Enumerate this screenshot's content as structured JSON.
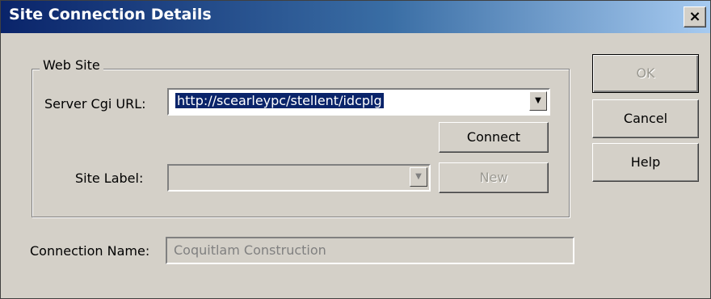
{
  "window": {
    "title": "Site Connection Details",
    "close_glyph": "×"
  },
  "web_site": {
    "group_label": "Web Site",
    "server_url_label": "Server Cgi URL:",
    "server_url_value": "http://scearleypc/stellent/idcplg",
    "connect_label": "Connect",
    "site_label_label": "Site Label:",
    "site_label_value": "",
    "new_label": "New"
  },
  "connection_name": {
    "label": "Connection Name:",
    "value": "Coquitlam Construction"
  },
  "buttons": {
    "ok": "OK",
    "cancel": "Cancel",
    "help": "Help"
  },
  "icons": {
    "dropdown": "chevron-down-icon",
    "close": "close-icon"
  },
  "colors": {
    "title_start": "#0a246a",
    "title_end": "#a6caf0",
    "face": "#d4d0c8",
    "selection": "#0a246a"
  }
}
